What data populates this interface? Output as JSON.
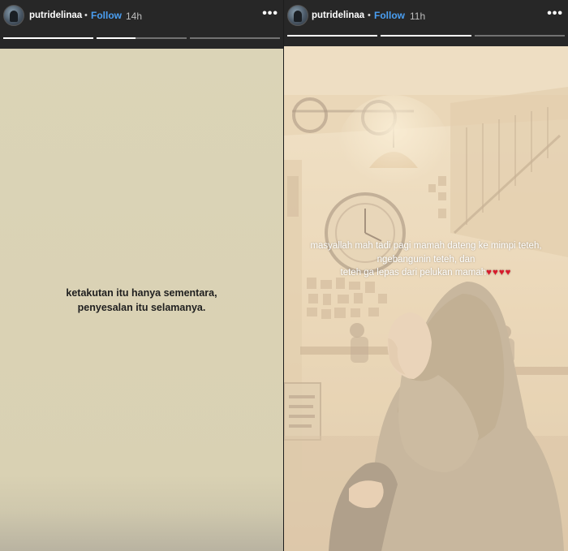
{
  "left_story": {
    "username": "putridelinaa",
    "separator": "•",
    "follow_label": "Follow",
    "time": "14h",
    "more_label": "•••",
    "progress": [
      1.0,
      0.43,
      0.0
    ],
    "text_line1": "ketakutan itu hanya sementara,",
    "text_line2": "penyesalan itu selamanya.",
    "bg_color": "#dbd4b7"
  },
  "right_story": {
    "username": "putridelinaa",
    "separator": "•",
    "follow_label": "Follow",
    "time": "11h",
    "more_label": "•••",
    "progress": [
      1.0,
      1.0,
      0.0
    ],
    "caption_line1": "masyallah mah tadi pagi mamah dateng ke mimpi teteh,",
    "caption_line2": "ngebangunin teteh, dan",
    "caption_line3": "teteh ga lepas dari pelukan mamah",
    "caption_emoji": "♥♥♥♥",
    "heart_color": "#d71b2c"
  },
  "icons": {
    "avatar": "profile-photo",
    "more": "more-options-icon"
  }
}
